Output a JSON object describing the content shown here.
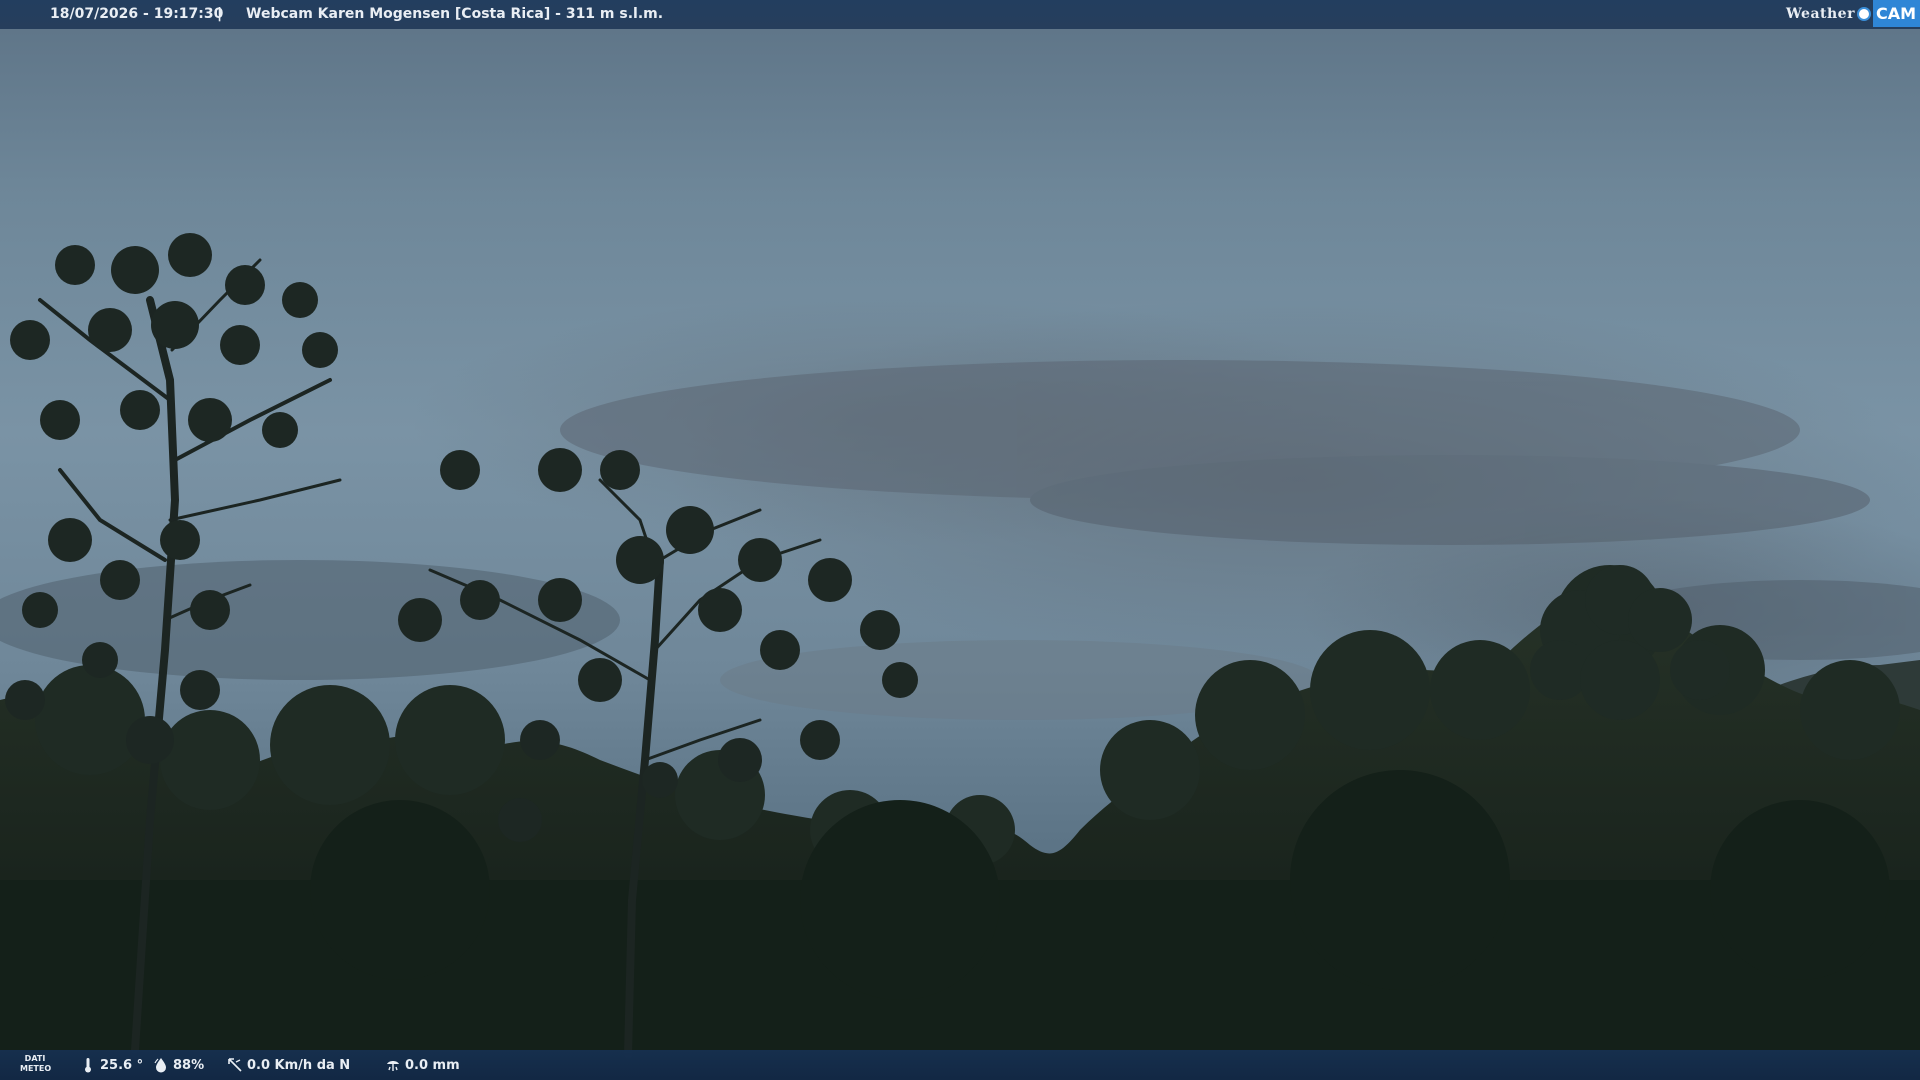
{
  "overlay": {
    "datetime": "18/07/2026 - 19:17:30",
    "separator": "|",
    "camera_title": "Webcam Karen Mogensen [Costa Rica]  - 311 m s.l.m.",
    "brand_weather": "Weather",
    "brand_cam": "CAM"
  },
  "weather_data": {
    "label_line1": "DATI",
    "label_line2": "METEO",
    "temperature": "25.6 °",
    "humidity": "88%",
    "wind": "0.0 Km/h da N",
    "rain": "0.0 mm"
  },
  "icons": {
    "temperature": "thermometer-icon",
    "humidity": "humidity-icon",
    "wind": "wind-icon",
    "rain": "rain-gauge-icon"
  },
  "colors": {
    "bar_background": "#1c3454",
    "brand_cam": "#2f86d6",
    "bar_text": "#e9eef4"
  }
}
